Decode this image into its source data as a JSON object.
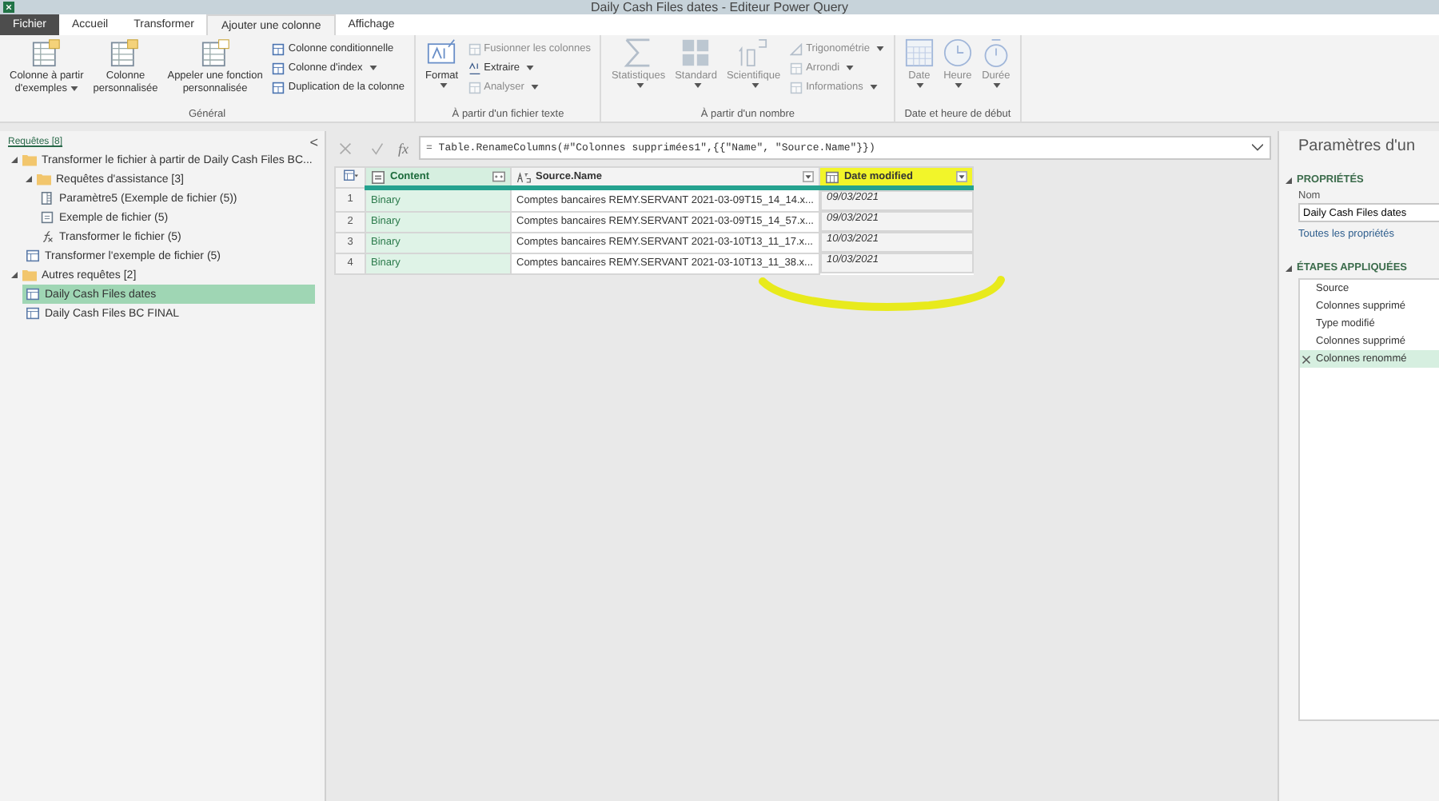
{
  "window": {
    "title": "Daily Cash Files dates - Editeur Power Query"
  },
  "tabs": [
    {
      "label": "Fichier",
      "kind": "file",
      "selected": false
    },
    {
      "label": "Accueil",
      "kind": "tab",
      "selected": false
    },
    {
      "label": "Transformer",
      "kind": "tab",
      "selected": false
    },
    {
      "label": "Ajouter une colonne",
      "kind": "tab",
      "selected": true
    },
    {
      "label": "Affichage",
      "kind": "tab",
      "selected": false
    }
  ],
  "ribbon_groups": [
    {
      "label": "Général",
      "large": [
        {
          "label": "Colonne à partir",
          "label2": "d'exemples",
          "has_menu": true,
          "disabled": false
        },
        {
          "label": "Colonne",
          "label2": "personnalisée",
          "has_menu": false,
          "disabled": false
        },
        {
          "label": "Appeler une fonction",
          "label2": "personnalisée",
          "has_menu": false,
          "disabled": false
        }
      ],
      "small": [
        {
          "label": "Colonne conditionnelle",
          "has_menu": false,
          "disabled": false
        },
        {
          "label": "Colonne d'index",
          "has_menu": true,
          "disabled": false
        },
        {
          "label": "Duplication de la colonne",
          "has_menu": false,
          "disabled": false
        }
      ]
    },
    {
      "label": "À partir d'un fichier texte",
      "large": [
        {
          "label": "Format",
          "has_menu": true,
          "disabled": false
        }
      ],
      "small": [
        {
          "label": "Fusionner les colonnes",
          "has_menu": false,
          "disabled": true
        },
        {
          "label": "Extraire",
          "has_menu": true,
          "disabled": false
        },
        {
          "label": "Analyser",
          "has_menu": true,
          "disabled": true
        }
      ]
    },
    {
      "label": "À partir d'un nombre",
      "large": [
        {
          "label": "Statistiques",
          "has_menu": true,
          "disabled": true
        },
        {
          "label": "Standard",
          "has_menu": true,
          "disabled": true
        },
        {
          "label": "Scientifique",
          "has_menu": true,
          "disabled": true
        }
      ],
      "small": [
        {
          "label": "Trigonométrie",
          "has_menu": true,
          "disabled": true
        },
        {
          "label": "Arrondi",
          "has_menu": true,
          "disabled": true
        },
        {
          "label": "Informations",
          "has_menu": true,
          "disabled": true
        }
      ]
    },
    {
      "label": "Date et heure de début",
      "large": [
        {
          "label": "Date",
          "has_menu": true,
          "disabled": true
        },
        {
          "label": "Heure",
          "has_menu": true,
          "disabled": true
        },
        {
          "label": "Durée",
          "has_menu": true,
          "disabled": true
        }
      ]
    }
  ],
  "queries": {
    "title": "Requêtes [8]",
    "collapse": "<",
    "items": [
      {
        "label": "Transformer le fichier à partir de Daily Cash Files BC...",
        "kind": "folder",
        "expanded": true,
        "selected": false,
        "children": [
          {
            "label": "Requêtes d'assistance [3]",
            "kind": "folder",
            "expanded": true,
            "selected": false,
            "children": [
              {
                "label": "Paramètre5 (Exemple de fichier (5))",
                "kind": "parameter",
                "selected": false
              },
              {
                "label": "Exemple de fichier (5)",
                "kind": "file",
                "selected": false
              },
              {
                "label": "Transformer le fichier (5)",
                "kind": "function",
                "selected": false
              }
            ]
          },
          {
            "label": "Transformer l'exemple de fichier (5)",
            "kind": "table",
            "selected": false
          }
        ]
      },
      {
        "label": "Autres requêtes [2]",
        "kind": "folder",
        "expanded": true,
        "selected": false,
        "children": [
          {
            "label": "Daily Cash Files dates",
            "kind": "table",
            "selected": true
          },
          {
            "label": "Daily Cash Files BC FINAL",
            "kind": "table",
            "selected": false
          }
        ]
      }
    ]
  },
  "formula_bar": {
    "function_label": "fx",
    "formula": "= Table.RenameColumns(#\"Colonnes supprimées1\",{{\"Name\", \"Source.Name\"}})"
  },
  "table": {
    "columns": [
      {
        "name": "Content",
        "kind": "binary",
        "selected": true,
        "highlighted": false
      },
      {
        "name": "Source.Name",
        "kind": "text",
        "selected": false,
        "highlighted": false
      },
      {
        "name": "Date modified",
        "kind": "date",
        "selected": false,
        "highlighted": true
      }
    ],
    "rows": [
      {
        "index": "1",
        "cells": [
          "Binary",
          "Comptes bancaires REMY.SERVANT 2021-03-09T15_14_14.x...",
          "09/03/2021"
        ]
      },
      {
        "index": "2",
        "cells": [
          "Binary",
          "Comptes bancaires REMY.SERVANT 2021-03-09T15_14_57.x...",
          "09/03/2021"
        ]
      },
      {
        "index": "3",
        "cells": [
          "Binary",
          "Comptes bancaires REMY.SERVANT 2021-03-10T13_11_17.x...",
          "10/03/2021"
        ]
      },
      {
        "index": "4",
        "cells": [
          "Binary",
          "Comptes bancaires REMY.SERVANT 2021-03-10T13_11_38.x...",
          "10/03/2021"
        ]
      }
    ]
  },
  "settings": {
    "title": "Paramètres d'un",
    "properties_heading": "PROPRIÉTÉS",
    "name_label": "Nom",
    "name_value": "Daily Cash Files dates",
    "all_properties_link": "Toutes les propriétés",
    "steps_heading": "ÉTAPES APPLIQUÉES",
    "steps": [
      {
        "label": "Source",
        "selected": false
      },
      {
        "label": "Colonnes supprimé",
        "selected": false
      },
      {
        "label": "Type modifié",
        "selected": false
      },
      {
        "label": "Colonnes supprimé",
        "selected": false
      },
      {
        "label": "Colonnes renommé",
        "selected": true
      }
    ]
  }
}
